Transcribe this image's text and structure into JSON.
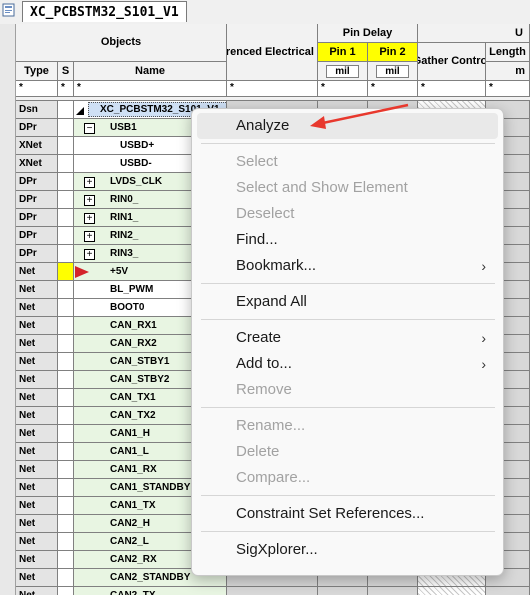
{
  "tab": {
    "title": "XC_PCBSTM32_S101_V1"
  },
  "headers": {
    "objects": "Objects",
    "ref_ecset": "Referenced Electrical CSet",
    "pin_delay": "Pin Delay",
    "pin1": "Pin 1",
    "pin2": "Pin 2",
    "gather_control": "Gather Control",
    "length_partial": "Length",
    "top_partial": "U",
    "type": "Type",
    "s": "S",
    "name": "Name",
    "unit_mil": "mil",
    "unit_partial": "m",
    "filter": "*"
  },
  "rows": [
    {
      "type": "Dsn",
      "name": "XC_PCBSTM32_S101_V1",
      "expander": "",
      "style": "sel"
    },
    {
      "type": "DPr",
      "name": "USB1",
      "expander": "−",
      "style": "green"
    },
    {
      "type": "XNet",
      "name": "USBD+",
      "expander": "",
      "style": "white",
      "indent": 2
    },
    {
      "type": "XNet",
      "name": "USBD-",
      "expander": "",
      "style": "white",
      "indent": 2
    },
    {
      "type": "DPr",
      "name": "LVDS_CLK",
      "expander": "+",
      "style": "green"
    },
    {
      "type": "DPr",
      "name": "RIN0_",
      "expander": "+",
      "style": "green"
    },
    {
      "type": "DPr",
      "name": "RIN1_",
      "expander": "+",
      "style": "green"
    },
    {
      "type": "DPr",
      "name": "RIN2_",
      "expander": "+",
      "style": "green"
    },
    {
      "type": "DPr",
      "name": "RIN3_",
      "expander": "+",
      "style": "green"
    },
    {
      "type": "Net",
      "name": "+5V",
      "expander": "",
      "style": "green",
      "flag": true
    },
    {
      "type": "Net",
      "name": "BL_PWM",
      "expander": "",
      "style": "white"
    },
    {
      "type": "Net",
      "name": "BOOT0",
      "expander": "",
      "style": "white"
    },
    {
      "type": "Net",
      "name": "CAN_RX1",
      "expander": "",
      "style": "green"
    },
    {
      "type": "Net",
      "name": "CAN_RX2",
      "expander": "",
      "style": "green"
    },
    {
      "type": "Net",
      "name": "CAN_STBY1",
      "expander": "",
      "style": "green"
    },
    {
      "type": "Net",
      "name": "CAN_STBY2",
      "expander": "",
      "style": "green"
    },
    {
      "type": "Net",
      "name": "CAN_TX1",
      "expander": "",
      "style": "green"
    },
    {
      "type": "Net",
      "name": "CAN_TX2",
      "expander": "",
      "style": "green"
    },
    {
      "type": "Net",
      "name": "CAN1_H",
      "expander": "",
      "style": "green"
    },
    {
      "type": "Net",
      "name": "CAN1_L",
      "expander": "",
      "style": "green"
    },
    {
      "type": "Net",
      "name": "CAN1_RX",
      "expander": "",
      "style": "green"
    },
    {
      "type": "Net",
      "name": "CAN1_STANDBY",
      "expander": "",
      "style": "green"
    },
    {
      "type": "Net",
      "name": "CAN1_TX",
      "expander": "",
      "style": "green"
    },
    {
      "type": "Net",
      "name": "CAN2_H",
      "expander": "",
      "style": "green"
    },
    {
      "type": "Net",
      "name": "CAN2_L",
      "expander": "",
      "style": "green"
    },
    {
      "type": "Net",
      "name": "CAN2_RX",
      "expander": "",
      "style": "green"
    },
    {
      "type": "Net",
      "name": "CAN2_STANDBY",
      "expander": "",
      "style": "green"
    },
    {
      "type": "Net",
      "name": "CAN2_TX",
      "expander": "",
      "style": "green"
    }
  ],
  "menu": {
    "items": [
      {
        "label": "Analyze",
        "state": "hover",
        "submenu": false
      },
      {
        "sep": true
      },
      {
        "label": "Select",
        "state": "disabled",
        "submenu": false
      },
      {
        "label": "Select and Show Element",
        "state": "disabled",
        "submenu": false
      },
      {
        "label": "Deselect",
        "state": "disabled",
        "submenu": false
      },
      {
        "label": "Find...",
        "state": "enabled",
        "submenu": false
      },
      {
        "label": "Bookmark...",
        "state": "enabled",
        "submenu": true
      },
      {
        "sep": true
      },
      {
        "label": "Expand All",
        "state": "enabled",
        "submenu": false
      },
      {
        "sep": true
      },
      {
        "label": "Create",
        "state": "enabled",
        "submenu": true
      },
      {
        "label": "Add to...",
        "state": "enabled",
        "submenu": true
      },
      {
        "label": "Remove",
        "state": "disabled",
        "submenu": false
      },
      {
        "sep": true
      },
      {
        "label": "Rename...",
        "state": "disabled",
        "submenu": false
      },
      {
        "label": "Delete",
        "state": "disabled",
        "submenu": false
      },
      {
        "label": "Compare...",
        "state": "disabled",
        "submenu": false
      },
      {
        "sep": true
      },
      {
        "label": "Constraint Set References...",
        "state": "enabled",
        "submenu": false
      },
      {
        "sep": true
      },
      {
        "label": "SigXplorer...",
        "state": "enabled",
        "submenu": false
      }
    ],
    "chevron": "›"
  },
  "colors": {
    "accent_arrow": "#e8382d",
    "pin_header": "#ffff00",
    "row_green": "#e8f5e2",
    "selection": "#cfe0f5"
  },
  "icons": {
    "tab_icon": "document-icon",
    "flag_icon": "triangle-flag-icon",
    "arrow": "red-pointer-arrow"
  }
}
